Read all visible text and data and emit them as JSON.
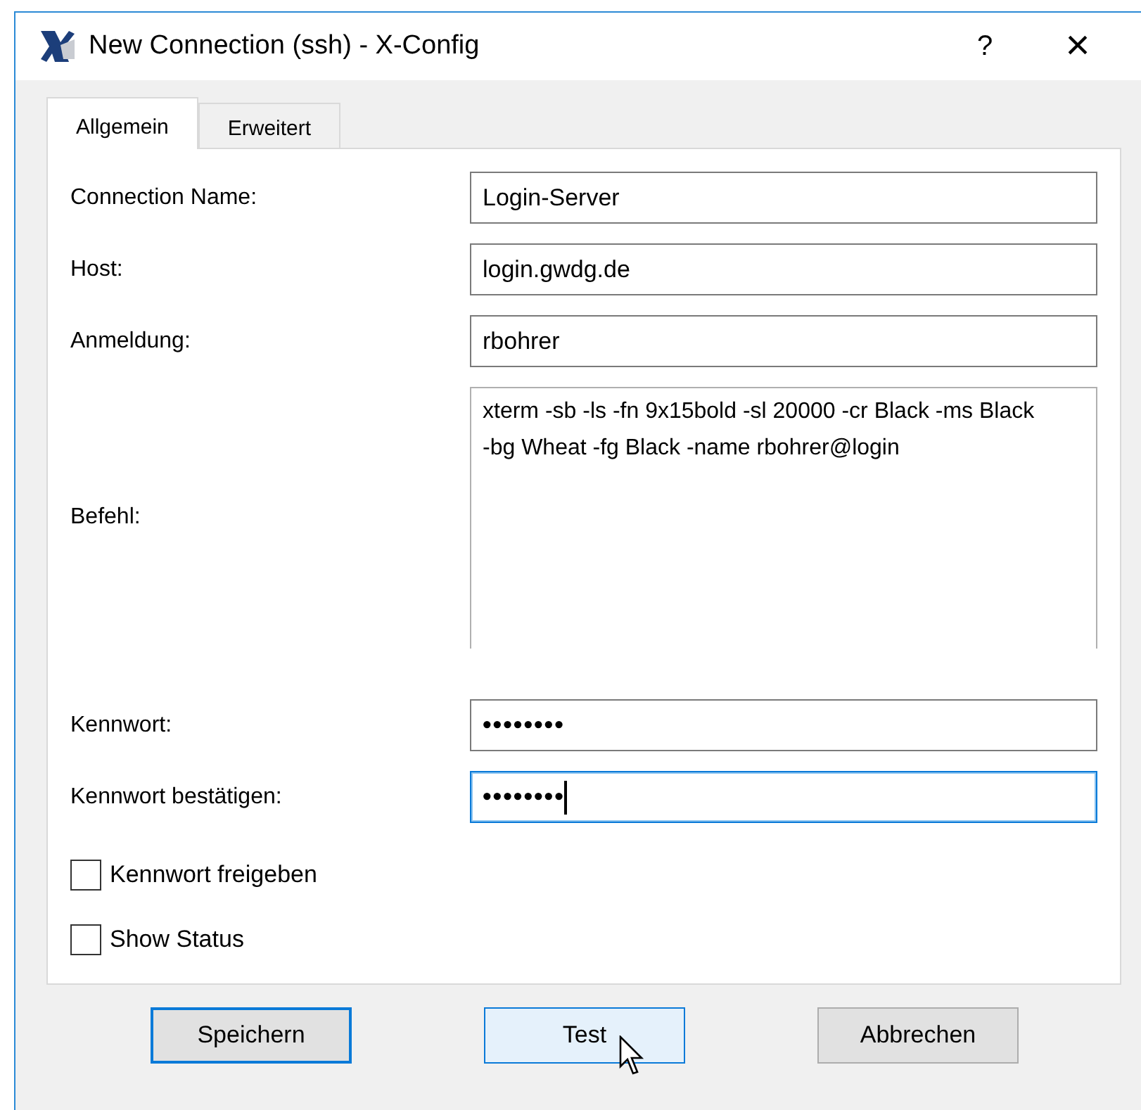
{
  "window": {
    "title": "New Connection (ssh) - X-Config",
    "help": "?",
    "close": "×"
  },
  "tabs": [
    {
      "label": "Allgemein",
      "selected": true
    },
    {
      "label": "Erweitert",
      "selected": false
    }
  ],
  "fields": [
    {
      "kind": "input",
      "label": "Connection Name:",
      "value": "Login-Server",
      "focused": false
    },
    {
      "kind": "input",
      "label": "Host:",
      "value": "login.gwdg.de",
      "focused": false
    },
    {
      "kind": "input",
      "label": "Anmeldung:",
      "value": "rbohrer",
      "focused": false
    },
    {
      "kind": "textarea",
      "label": "Befehl:",
      "value": "xterm -sb -ls -fn 9x15bold -sl 20000 -cr Black -ms Black -bg Wheat -fg Black -name rbohrer@login",
      "focused": false
    },
    {
      "kind": "password",
      "label": "Kennwort:",
      "value": "••••••••",
      "focused": false
    },
    {
      "kind": "password",
      "label": "Kennwort bestätigen:",
      "value": "••••••••",
      "focused": true
    }
  ],
  "checkboxes": [
    {
      "label": "Kennwort freigeben",
      "checked": false
    },
    {
      "label": "Show Status",
      "checked": false
    }
  ],
  "buttons": [
    {
      "label": "Speichern",
      "default": true,
      "hovered": false
    },
    {
      "label": "Test",
      "default": false,
      "hovered": true
    },
    {
      "label": "Abbrechen",
      "default": false,
      "hovered": false
    }
  ]
}
